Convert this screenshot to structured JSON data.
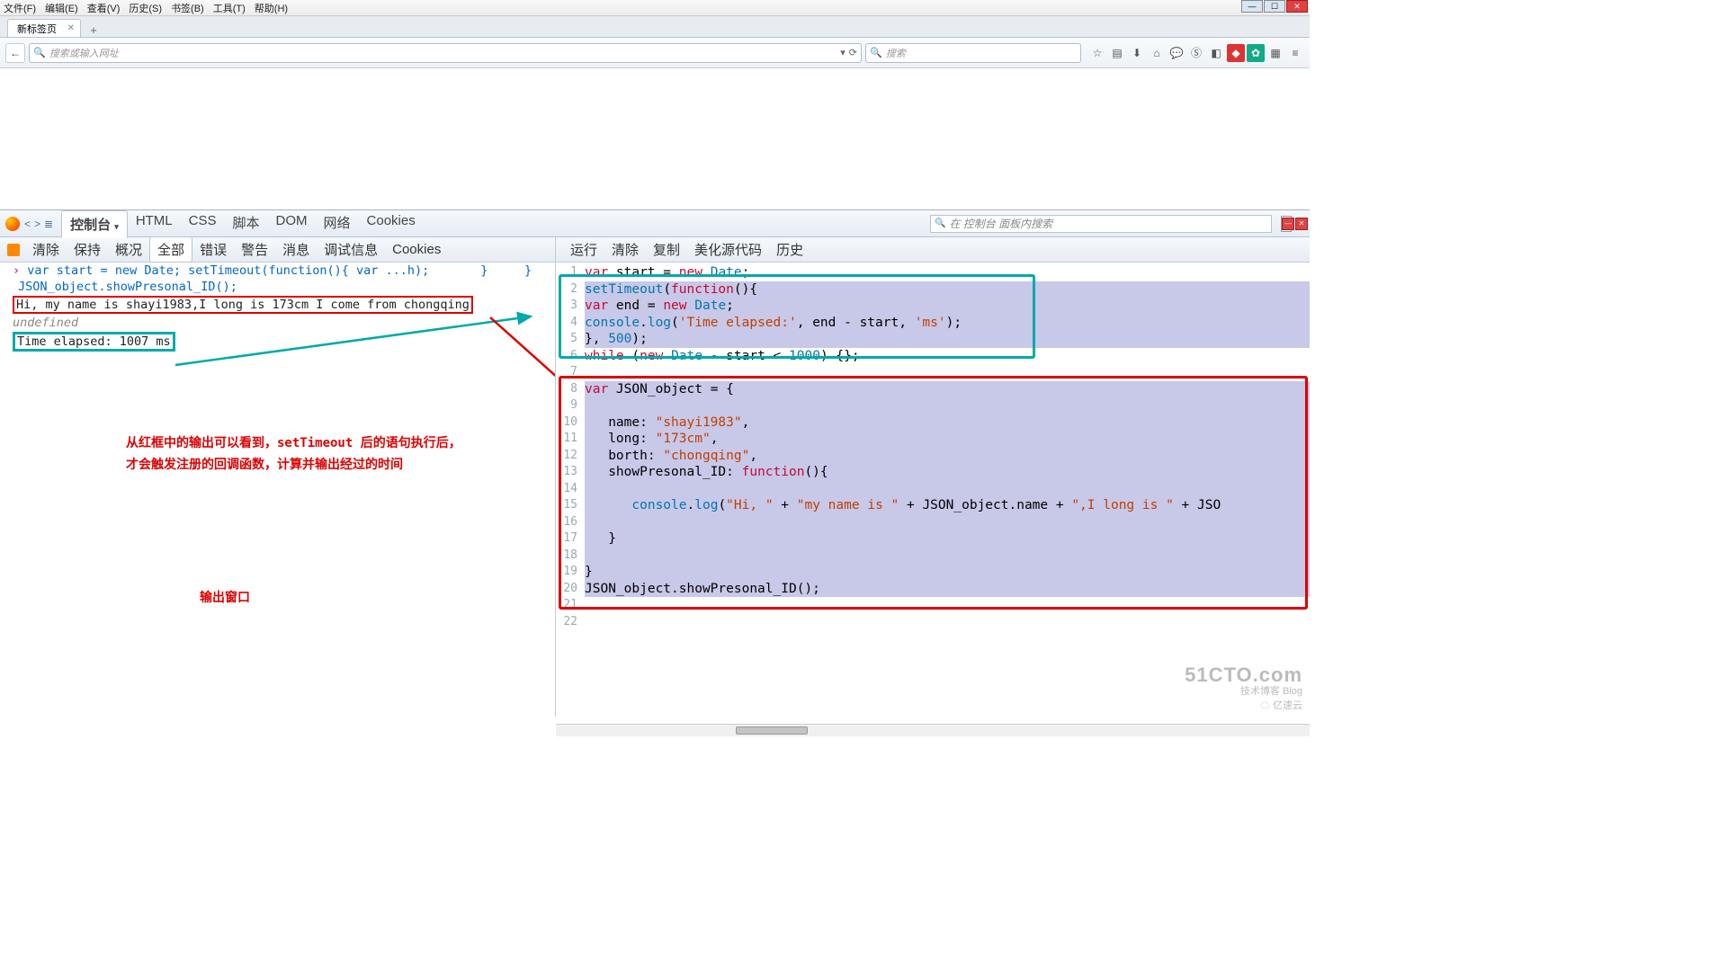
{
  "menu": {
    "file": "文件(F)",
    "edit": "编辑(E)",
    "view": "查看(V)",
    "history": "历史(S)",
    "bookmarks": "书签(B)",
    "tools": "工具(T)",
    "help": "帮助(H)"
  },
  "tab": {
    "title": "新标签页"
  },
  "nav": {
    "url_placeholder": "搜索或输入网址",
    "search_placeholder": "搜索"
  },
  "dev": {
    "tabs": {
      "console": "控制台",
      "html": "HTML",
      "css": "CSS",
      "script": "脚本",
      "dom": "DOM",
      "net": "网络",
      "cookies": "Cookies"
    },
    "search_placeholder": "在 控制台 面板内搜索",
    "left_sub": {
      "clear": "清除",
      "persist": "保持",
      "profile": "概况",
      "all": "全部",
      "errors": "错误",
      "warnings": "警告",
      "info": "消息",
      "debug": "调试信息",
      "cookies": "Cookies"
    },
    "right_sub": {
      "run": "运行",
      "clear": "清除",
      "copy": "复制",
      "pretty": "美化源代码",
      "history": "历史"
    }
  },
  "console": {
    "l1_a": "var start = new Date; setTimeout(function(){ var ...h);       }     }",
    "l1_b": "JSON_object.showPresonal_ID();",
    "out1": "Hi, my name is shayi1983,I long is 173cm I come from chongqing",
    "undef": "undefined",
    "out2": "Time elapsed: 1007 ms"
  },
  "annot": {
    "line1": "从红框中的输出可以看到，setTimeout 后的语句执行后，",
    "line2": "才会触发注册的回调函数，计算并输出经过的时间",
    "outwin": "输出窗口"
  },
  "code": {
    "lines": [
      "var start = new Date;",
      "setTimeout(function(){",
      "var end = new Date;",
      "console.log('Time elapsed:', end - start, 'ms');",
      "}, 500);",
      "while (new Date - start < 1000) {};",
      "",
      "var JSON_object = {",
      "",
      "   name: \"shayi1983\",",
      "   long: \"173cm\",",
      "   borth: \"chongqing\",",
      "   showPresonal_ID: function(){",
      "",
      "      console.log(\"Hi, \" + \"my name is \" + JSON_object.name + \",I long is \" + JSO",
      "",
      "   }",
      "",
      "}",
      "JSON_object.showPresonal_ID();",
      "",
      ""
    ]
  },
  "watermark": {
    "l1": "51CTO.com",
    "l2": "技术博客   Blog",
    "l3": "亿速云"
  }
}
